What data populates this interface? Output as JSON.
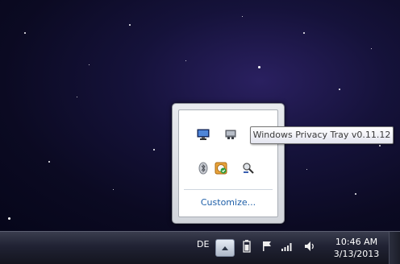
{
  "tooltip": {
    "text": "Windows Privacy Tray v0.11.12"
  },
  "flyout": {
    "customize_label": "Customize...",
    "icons": [
      "network-monitor-icon",
      "printer-icon",
      "bluetooth-icon",
      "security-shield-icon",
      "windows-privacy-tray-icon"
    ]
  },
  "taskbar": {
    "language": "DE",
    "time": "10:46 AM",
    "date": "3/13/2013",
    "icons": [
      "battery-icon",
      "action-center-flag-icon",
      "network-signal-icon",
      "volume-icon"
    ]
  },
  "colors": {
    "link": "#1e5fa8",
    "taskbar": "#202233"
  }
}
